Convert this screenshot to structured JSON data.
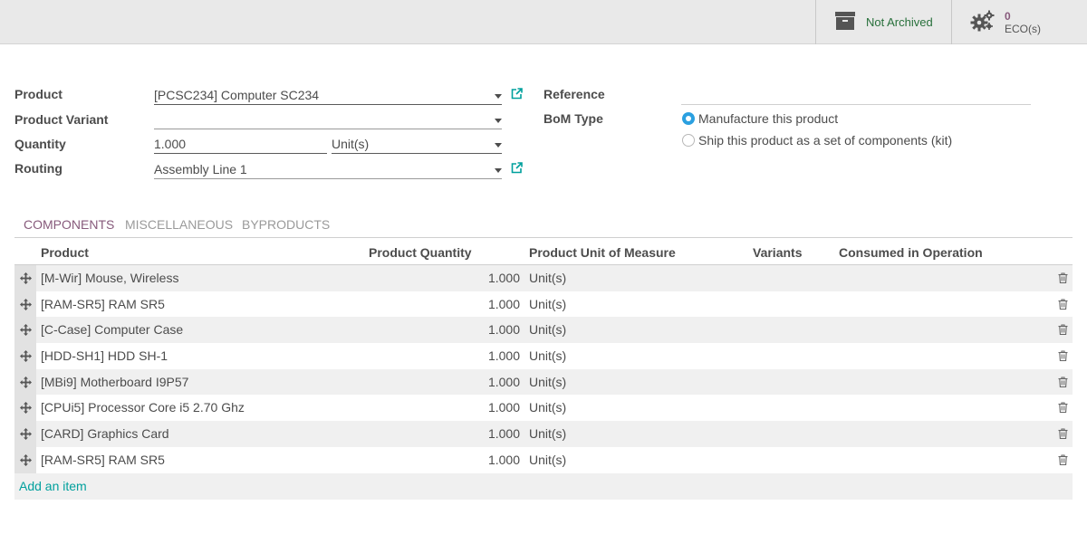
{
  "header": {
    "archive_label": "Not Archived",
    "eco_count": "0",
    "eco_label": "ECO(s)",
    "icons": {
      "archive": "archive-box-icon",
      "eco": "gears-icon"
    }
  },
  "form": {
    "product_label": "Product",
    "product_value": "[PCSC234] Computer SC234",
    "variant_label": "Product Variant",
    "variant_value": "",
    "quantity_label": "Quantity",
    "quantity_value": "1.000",
    "uom_value": "Unit(s)",
    "routing_label": "Routing",
    "routing_value": "Assembly Line 1",
    "reference_label": "Reference",
    "reference_value": "",
    "bom_type_label": "BoM Type",
    "bom_type_options": [
      {
        "label": "Manufacture this product",
        "checked": true
      },
      {
        "label": "Ship this product as a set of components (kit)",
        "checked": false
      }
    ]
  },
  "tabs": [
    {
      "label": "COMPONENTS",
      "active": true
    },
    {
      "label": "MISCELLANEOUS",
      "active": false
    },
    {
      "label": "BYPRODUCTS",
      "active": false
    }
  ],
  "table": {
    "columns": [
      "Product",
      "Product Quantity",
      "Product Unit of Measure",
      "Variants",
      "Consumed in Operation"
    ],
    "rows": [
      {
        "product": "[M-Wir] Mouse, Wireless",
        "qty": "1.000",
        "uom": "Unit(s)"
      },
      {
        "product": "[RAM-SR5] RAM SR5",
        "qty": "1.000",
        "uom": "Unit(s)"
      },
      {
        "product": "[C-Case] Computer Case",
        "qty": "1.000",
        "uom": "Unit(s)"
      },
      {
        "product": "[HDD-SH1] HDD SH-1",
        "qty": "1.000",
        "uom": "Unit(s)"
      },
      {
        "product": "[MBi9] Motherboard I9P57",
        "qty": "1.000",
        "uom": "Unit(s)"
      },
      {
        "product": "[CPUi5] Processor Core i5 2.70 Ghz",
        "qty": "1.000",
        "uom": "Unit(s)"
      },
      {
        "product": "[CARD] Graphics Card",
        "qty": "1.000",
        "uom": "Unit(s)"
      },
      {
        "product": "[RAM-SR5] RAM SR5",
        "qty": "1.000",
        "uom": "Unit(s)"
      }
    ],
    "add_item_label": "Add an item"
  },
  "colors": {
    "accent": "#875a7b",
    "link": "#00a09d",
    "archived_green": "#28703b",
    "radio_blue": "#2ba0e0"
  }
}
